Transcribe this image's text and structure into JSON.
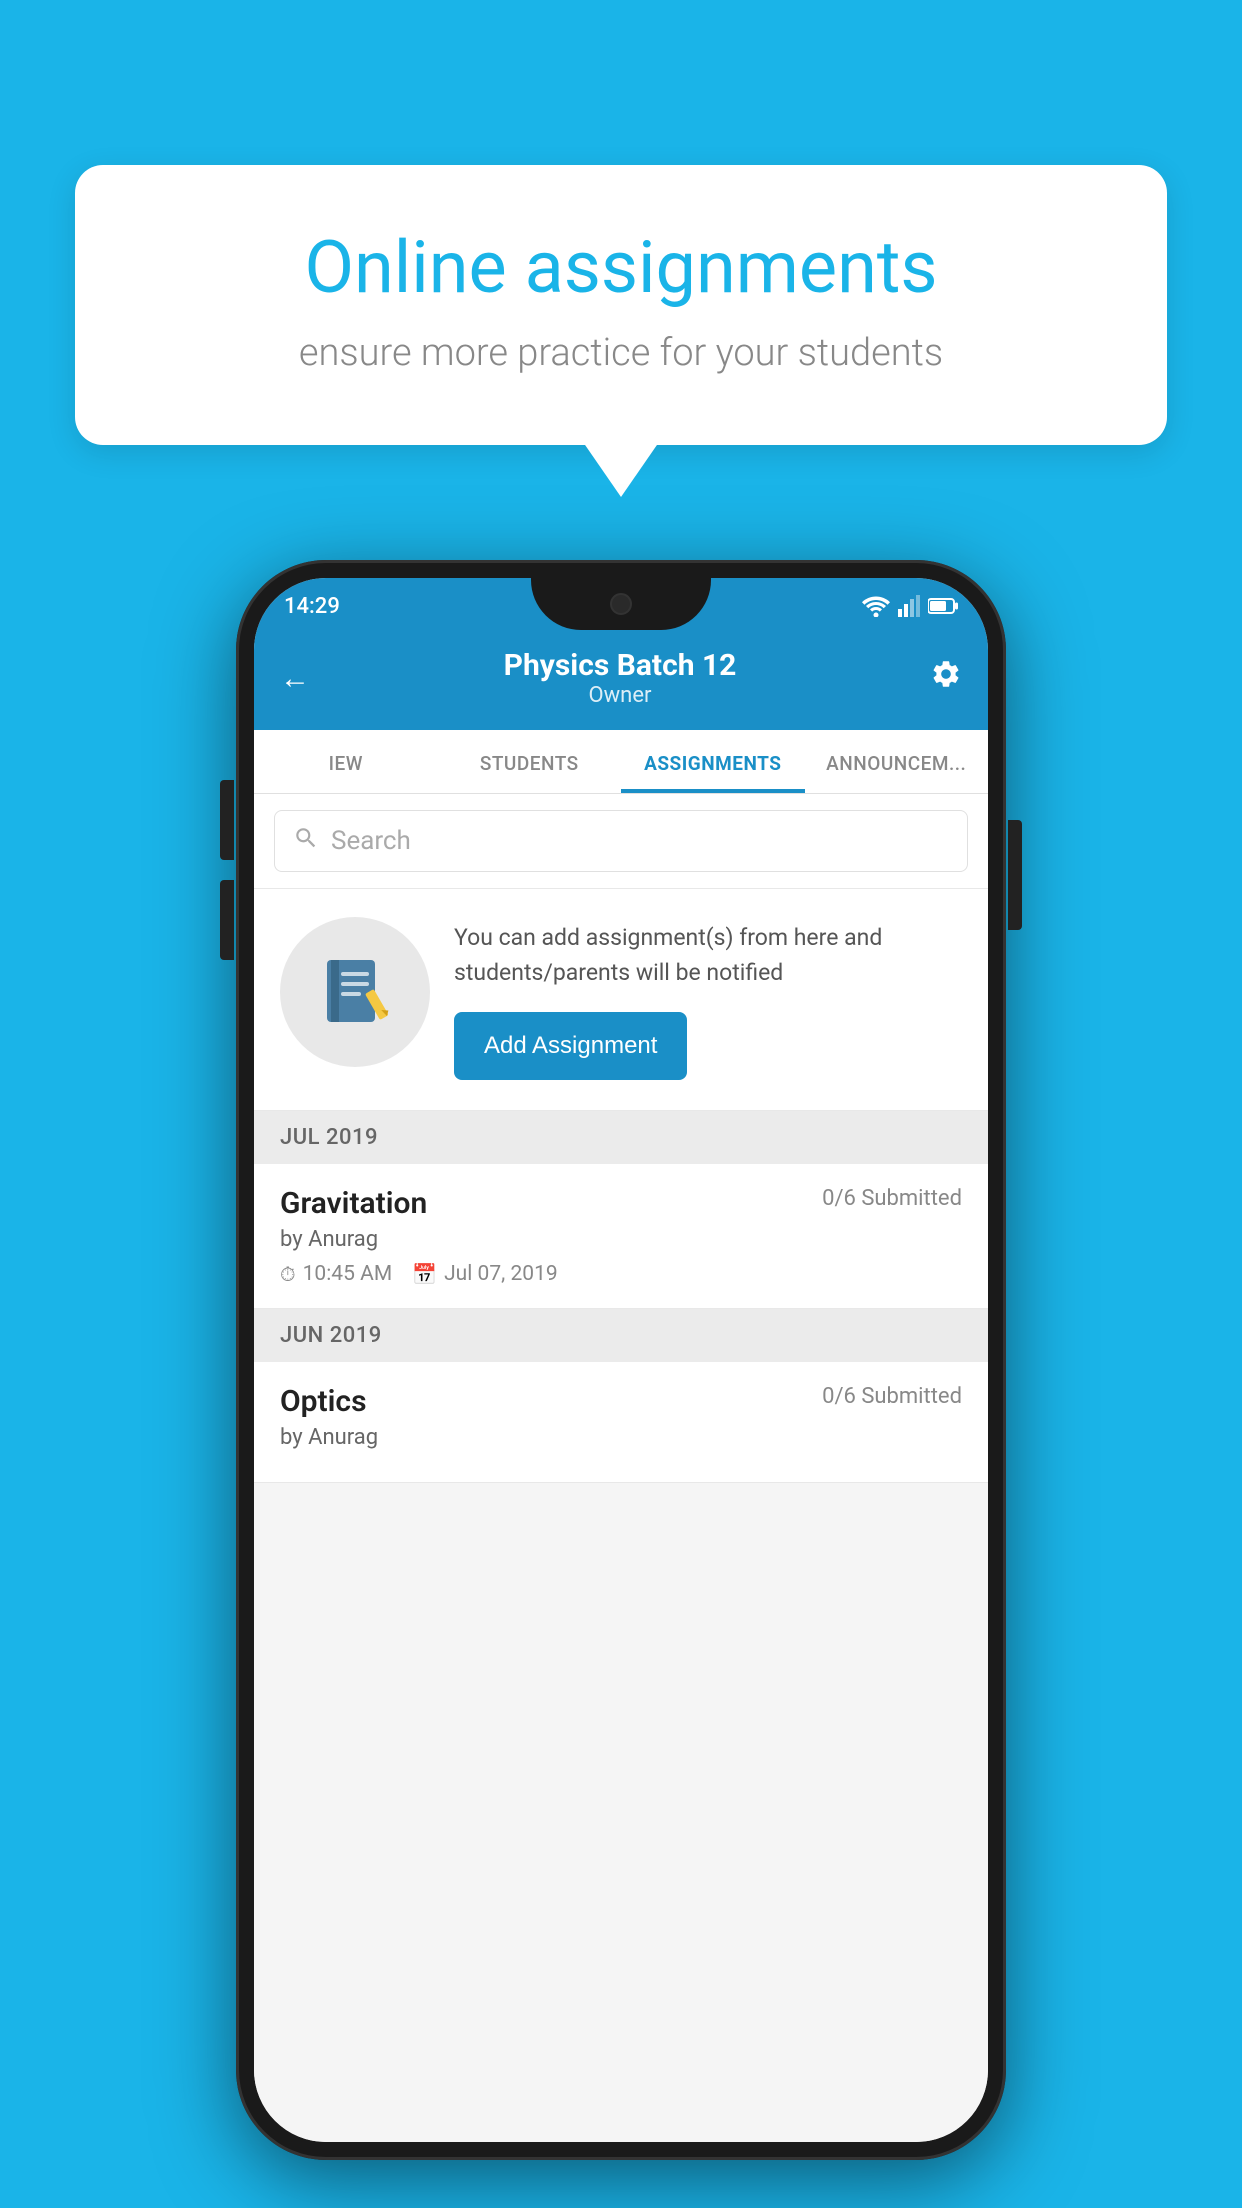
{
  "background_color": "#1ab4e8",
  "speech_bubble": {
    "title": "Online assignments",
    "subtitle": "ensure more practice for your students"
  },
  "phone": {
    "status_bar": {
      "time": "14:29"
    },
    "header": {
      "title": "Physics Batch 12",
      "subtitle": "Owner",
      "back_label": "←",
      "gear_label": "⚙"
    },
    "tabs": [
      {
        "label": "IEW",
        "active": false
      },
      {
        "label": "STUDENTS",
        "active": false
      },
      {
        "label": "ASSIGNMENTS",
        "active": true
      },
      {
        "label": "ANNOUNCEM...",
        "active": false
      }
    ],
    "search": {
      "placeholder": "Search"
    },
    "promo": {
      "text": "You can add assignment(s) from here and students/parents will be notified",
      "button_label": "Add Assignment"
    },
    "month_sections": [
      {
        "month": "JUL 2019",
        "assignments": [
          {
            "name": "Gravitation",
            "submitted": "0/6 Submitted",
            "by": "by Anurag",
            "time": "10:45 AM",
            "date": "Jul 07, 2019"
          }
        ]
      },
      {
        "month": "JUN 2019",
        "assignments": [
          {
            "name": "Optics",
            "submitted": "0/6 Submitted",
            "by": "by Anurag",
            "time": "",
            "date": ""
          }
        ]
      }
    ]
  }
}
